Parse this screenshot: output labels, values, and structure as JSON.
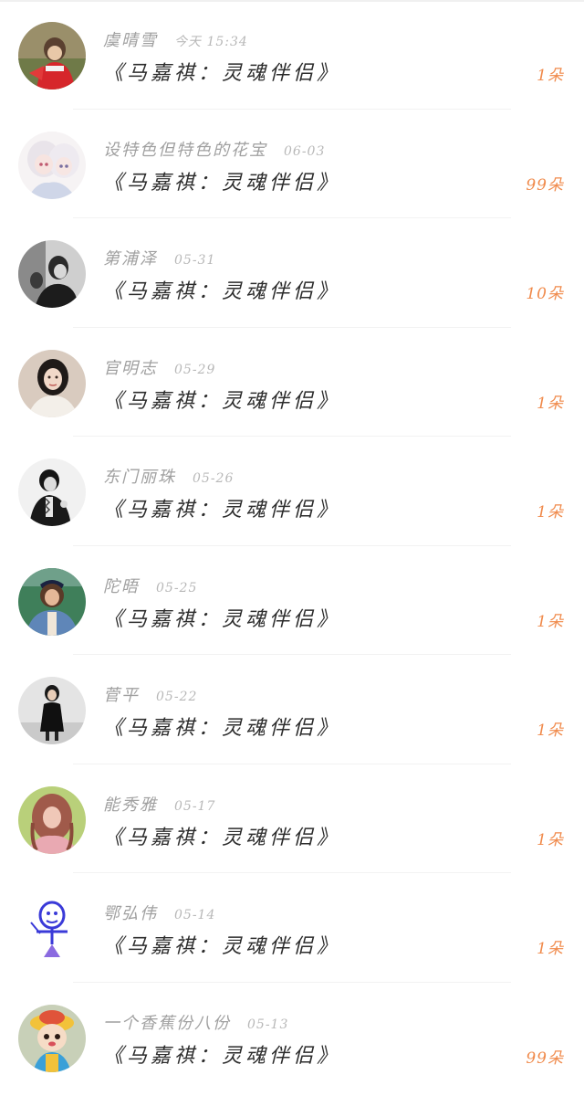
{
  "list": {
    "items": [
      {
        "name": "虞晴雪",
        "date": "今天 15:34",
        "work": "《马嘉祺：灵魂伴侣》",
        "gift": "1朵",
        "avatar": "avatar-red-costume"
      },
      {
        "name": "设特色但特色的花宝",
        "date": "06-03",
        "work": "《马嘉祺：灵魂伴侣》",
        "gift": "99朵",
        "avatar": "avatar-anime-girls"
      },
      {
        "name": "第浦泽",
        "date": "05-31",
        "work": "《马嘉祺：灵魂伴侣》",
        "gift": "10朵",
        "avatar": "avatar-bw-portrait"
      },
      {
        "name": "官明志",
        "date": "05-29",
        "work": "《马嘉祺：灵魂伴侣》",
        "gift": "1朵",
        "avatar": "avatar-woman-portrait"
      },
      {
        "name": "东门丽珠",
        "date": "05-26",
        "work": "《马嘉祺：灵魂伴侣》",
        "gift": "1朵",
        "avatar": "avatar-bw-man"
      },
      {
        "name": "陀晤",
        "date": "05-25",
        "work": "《马嘉祺：灵魂伴侣》",
        "gift": "1朵",
        "avatar": "avatar-woman-denim"
      },
      {
        "name": "菅平",
        "date": "05-22",
        "work": "《马嘉祺：灵魂伴侣》",
        "gift": "1朵",
        "avatar": "avatar-girl-black-dress"
      },
      {
        "name": "能秀雅",
        "date": "05-17",
        "work": "《马嘉祺：灵魂伴侣》",
        "gift": "1朵",
        "avatar": "avatar-girl-pink"
      },
      {
        "name": "鄂弘伟",
        "date": "05-14",
        "work": "《马嘉祺：灵魂伴侣》",
        "gift": "1朵",
        "avatar": "avatar-doodle"
      },
      {
        "name": "一个香蕉份八份",
        "date": "05-13",
        "work": "《马嘉祺：灵魂伴侣》",
        "gift": "99朵",
        "avatar": "avatar-cartoon-doll"
      }
    ]
  }
}
